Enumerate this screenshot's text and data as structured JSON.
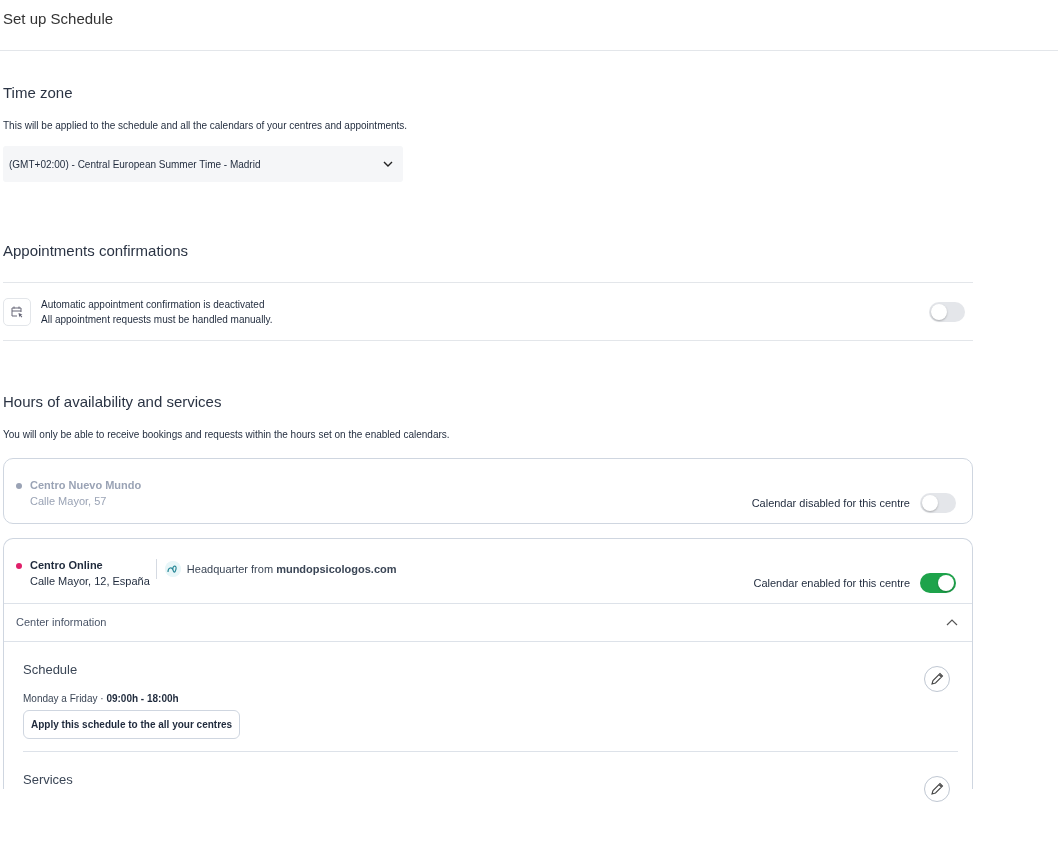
{
  "header": {
    "title": "Set up Schedule"
  },
  "time_zone": {
    "title": "Time zone",
    "description": "This will be applied to the schedule and all the calendars of your centres and appointments.",
    "select": {
      "value": "(GMT+02:00) - Central European Summer Time - Madrid"
    }
  },
  "confirmations": {
    "title": "Appointments confirmations",
    "setting": {
      "title": "Automatic appointment confirmation is deactivated",
      "subtitle": "All appointment requests must be handled manually.",
      "on": false
    }
  },
  "availability": {
    "title": "Hours of availability and services",
    "description": "You will only be able to receive bookings and requests within the hours set on the enabled calendars.",
    "centres": [
      {
        "name": "Centro Nuevo Mundo",
        "address": "Calle Mayor, 57",
        "color": "#9aa3b5",
        "status_label": "Calendar disabled for this centre",
        "enabled": false
      },
      {
        "name": "Centro Online",
        "address": "Calle Mayor, 12, España",
        "color": "#e0206a",
        "headquarter": "Headquarter from **mundopsicologos.com**",
        "status_label": "Calendar enabled for this centre",
        "enabled": true,
        "info": {
          "label": "Center information",
          "expanded": true,
          "sections": [
            {
              "title": "Schedule",
              "detail": "Monday a Friday ·  **09:00h - 18:00h**",
              "button": "Apply this schedule to the all your centres"
            },
            {
              "title": "Services"
            }
          ]
        }
      }
    ]
  }
}
